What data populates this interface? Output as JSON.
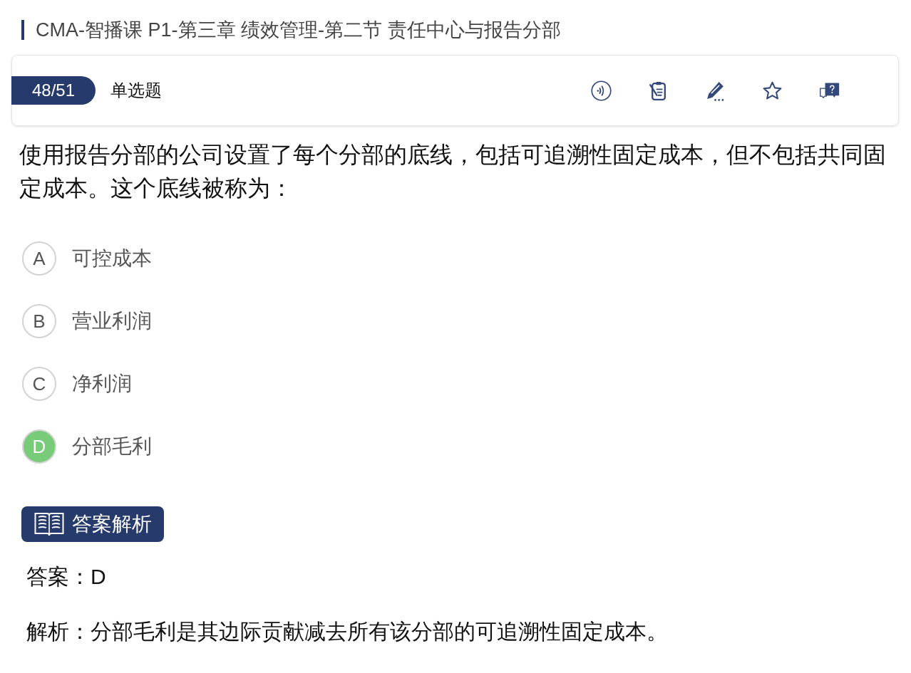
{
  "header": {
    "title": "CMA-智播课 P1-第三章 绩效管理-第二节 责任中心与报告分部"
  },
  "question_bar": {
    "progress": "48/51",
    "type": "单选题"
  },
  "question": {
    "text": "使用报告分部的公司设置了每个分部的底线，包括可追溯性固定成本，但不包括共同固定成本。这个底线被称为：",
    "options": [
      {
        "letter": "A",
        "text": "可控成本",
        "selected": false
      },
      {
        "letter": "B",
        "text": "营业利润",
        "selected": false
      },
      {
        "letter": "C",
        "text": "净利润",
        "selected": false
      },
      {
        "letter": "D",
        "text": "分部毛利",
        "selected": true
      }
    ]
  },
  "answer_section": {
    "button": "答案解析",
    "answer": "答案：D",
    "explanation": "解析：分部毛利是其边际贡献减去所有该分部的可追溯性固定成本。"
  }
}
